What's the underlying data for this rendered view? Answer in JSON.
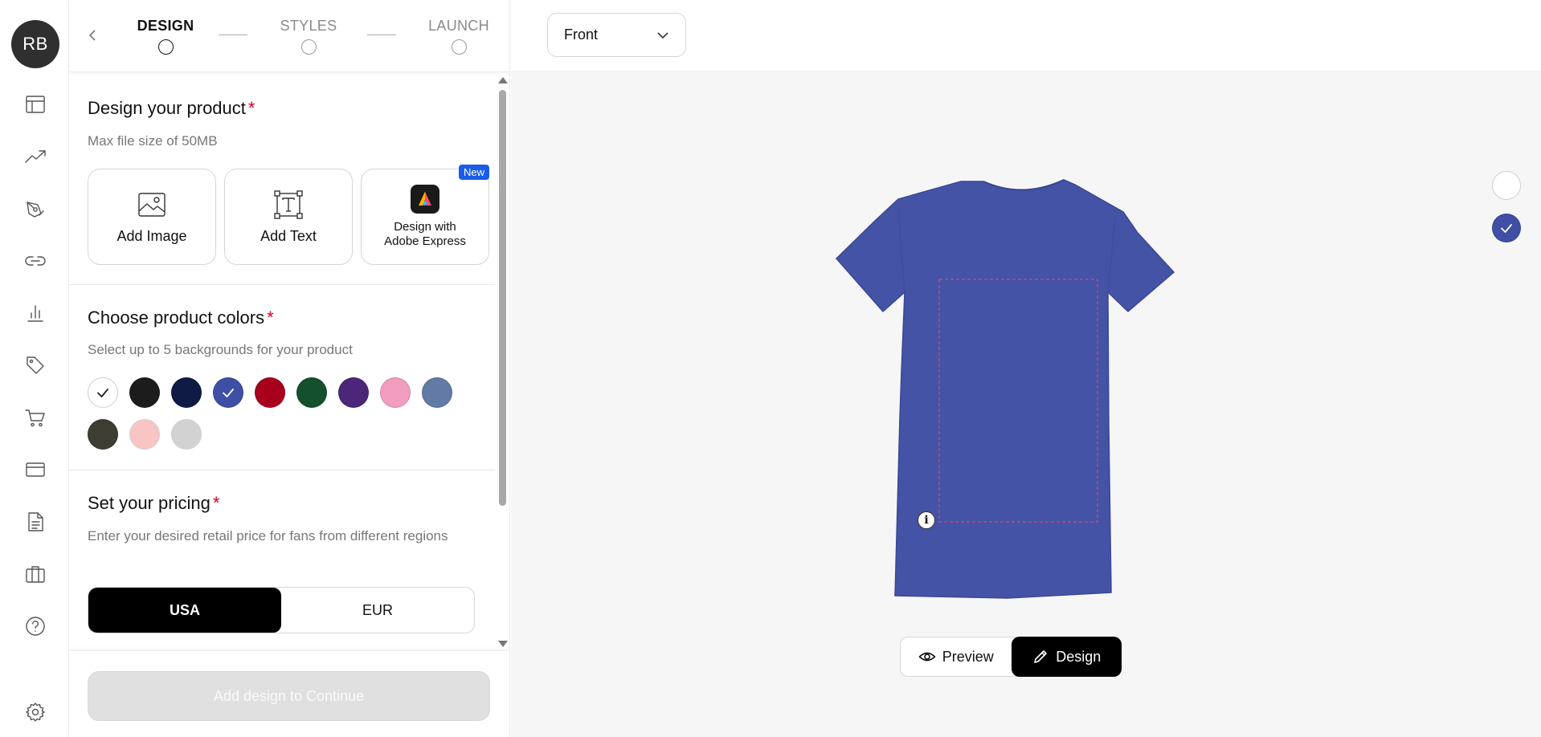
{
  "user": {
    "initials": "RB"
  },
  "rail_icons": [
    "layout-icon",
    "trend-icon",
    "pen-tool-icon",
    "link-icon",
    "bar-chart-icon",
    "tag-icon",
    "cart-icon",
    "credit-card-icon",
    "document-icon",
    "briefcase-icon",
    "help-icon",
    "settings-icon"
  ],
  "stepper": {
    "steps": [
      {
        "label": "DESIGN",
        "active": true
      },
      {
        "label": "STYLES",
        "active": false
      },
      {
        "label": "LAUNCH",
        "active": false
      }
    ]
  },
  "design_section": {
    "title": "Design your product",
    "required": "*",
    "subtitle": "Max file size of 50MB",
    "tiles": {
      "add_image": "Add Image",
      "add_text": "Add Text",
      "adobe_line1": "Design with",
      "adobe_line2": "Adobe Express",
      "new_badge": "New"
    }
  },
  "colors_section": {
    "title": "Choose product colors",
    "required": "*",
    "subtitle": "Select up to 5 backgrounds for your product",
    "swatches": [
      {
        "name": "white",
        "color": "#ffffff",
        "selected": true
      },
      {
        "name": "black",
        "color": "#1c1c1c",
        "selected": false
      },
      {
        "name": "navy",
        "color": "#0f1a45",
        "selected": false
      },
      {
        "name": "royal",
        "color": "#3f4fa6",
        "selected": true
      },
      {
        "name": "red",
        "color": "#a8001c",
        "selected": false
      },
      {
        "name": "forest",
        "color": "#13502b",
        "selected": false
      },
      {
        "name": "purple",
        "color": "#4c2678",
        "selected": false
      },
      {
        "name": "pink",
        "color": "#f29cbf",
        "selected": false
      },
      {
        "name": "slate-blue",
        "color": "#627aa5",
        "selected": false
      },
      {
        "name": "charcoal",
        "color": "#3d3d33",
        "selected": false
      },
      {
        "name": "light-pink",
        "color": "#f8c4c4",
        "selected": false
      },
      {
        "name": "light-grey",
        "color": "#d2d2d2",
        "selected": false
      }
    ]
  },
  "pricing_section": {
    "title": "Set your pricing",
    "required": "*",
    "subtitle": "Enter your desired retail price for fans from different regions",
    "regions": [
      {
        "label": "USA",
        "active": true
      },
      {
        "label": "EUR",
        "active": false
      }
    ]
  },
  "footer": {
    "continue_label": "Add design to Continue"
  },
  "canvas": {
    "view_select": "Front",
    "shirt_color": "#4453a6",
    "toggle": {
      "preview_label": "Preview",
      "design_label": "Design",
      "active": "Design"
    },
    "side_swatches": [
      {
        "name": "white",
        "color": "#ffffff",
        "selected": false
      },
      {
        "name": "royal",
        "color": "#3f4fa6",
        "selected": true
      }
    ]
  }
}
